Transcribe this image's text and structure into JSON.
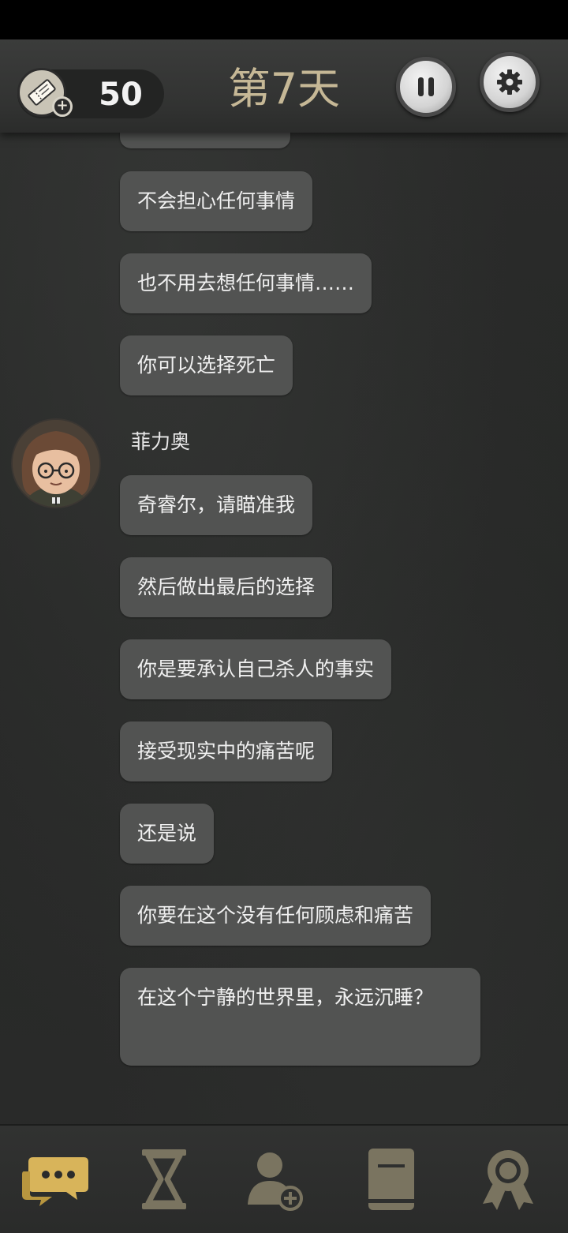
{
  "header": {
    "ticket_count": "50",
    "day_title": "第7天"
  },
  "chat": {
    "messages_before": [
      "不会担心任何事情",
      "也不用去想任何事情……",
      "你可以选择死亡"
    ],
    "sender": {
      "name": "菲力奥"
    },
    "messages_after": [
      "奇睿尔，请瞄准我",
      "然后做出最后的选择",
      "你是要承认自己杀人的事实",
      "接受现实中的痛苦呢",
      "还是说",
      "你要在这个没有任何顾虑和痛苦",
      "在这个宁静的世界里，永远沉睡？"
    ]
  },
  "nav": {
    "items": [
      "chat-icon",
      "hourglass-icon",
      "add-contact-icon",
      "book-icon",
      "achievement-icon"
    ],
    "active_color": "#d8b45a",
    "inactive_color": "#7a7460"
  },
  "colors": {
    "bubble": "#525352",
    "title": "#c6b896"
  }
}
